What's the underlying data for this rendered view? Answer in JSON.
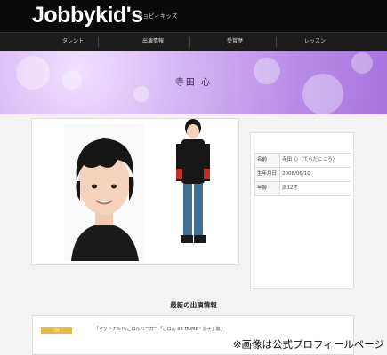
{
  "site": {
    "logo": "Jobbykid's",
    "logo_sub": "ジョビィキッズ"
  },
  "nav": {
    "items": [
      {
        "label": "タレント"
      },
      {
        "label": "出演情報"
      },
      {
        "label": "受賞歴"
      },
      {
        "label": "レッスン"
      }
    ]
  },
  "banner": {
    "name": "寺田 心"
  },
  "profile": {
    "rows": [
      {
        "key": "名前",
        "value": "寺田 心（てらだこころ）"
      },
      {
        "key": "生年月日",
        "value": "2008/06/10"
      },
      {
        "key": "年齢",
        "value": "満12才"
      }
    ]
  },
  "latest": {
    "title": "最新の出演情報"
  },
  "news": {
    "badge": "CM",
    "text": "「マクドナルド/ごはんバーガー「ごはん a t HOME・息子」篇」"
  },
  "caption": "※画像は公式プロフィールページ",
  "colors": {
    "header_bg": "#0a0a0a",
    "banner_purple": "#b98de6",
    "badge_yellow": "#e8b746"
  }
}
